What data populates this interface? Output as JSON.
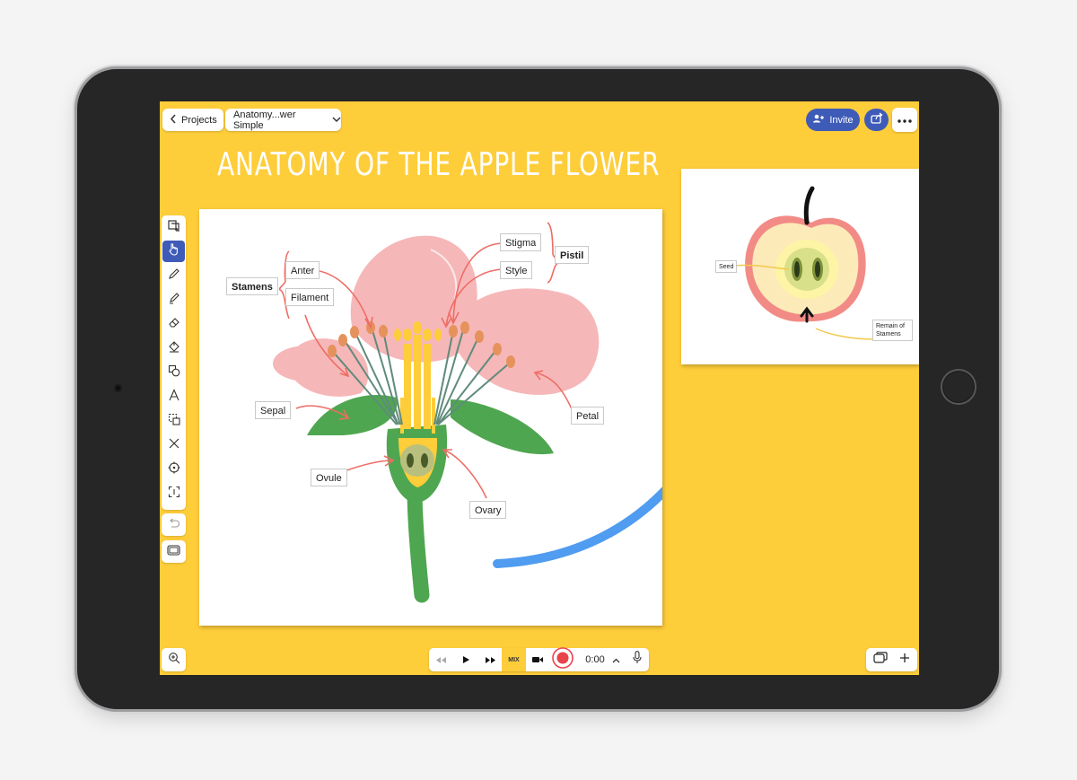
{
  "header": {
    "projects_label": "Projects",
    "doc_title": "Anatomy...wer Simple",
    "invite_label": "Invite"
  },
  "canvas": {
    "title": "ANATOMY OF THE APPLE FLOWER"
  },
  "flower_labels": {
    "stamens": "Stamens",
    "anter": "Anter",
    "filament": "Filament",
    "stigma": "Stigma",
    "style": "Style",
    "pistil": "Pistil",
    "sepal": "Sepal",
    "petal": "Petal",
    "ovule": "Ovule",
    "ovary": "Ovary"
  },
  "apple_labels": {
    "seed": "Seed",
    "remain_of_stamens": "Remain of Stamens"
  },
  "playback": {
    "mix_label": "MIX",
    "time": "0:00"
  },
  "colors": {
    "canvas_background": "#fecd3a",
    "accent": "#3f5bb8",
    "arrow": "#4f9cf0",
    "petal": "#f6b7b9",
    "leaf": "#4fa650",
    "record": "#e8424a"
  }
}
